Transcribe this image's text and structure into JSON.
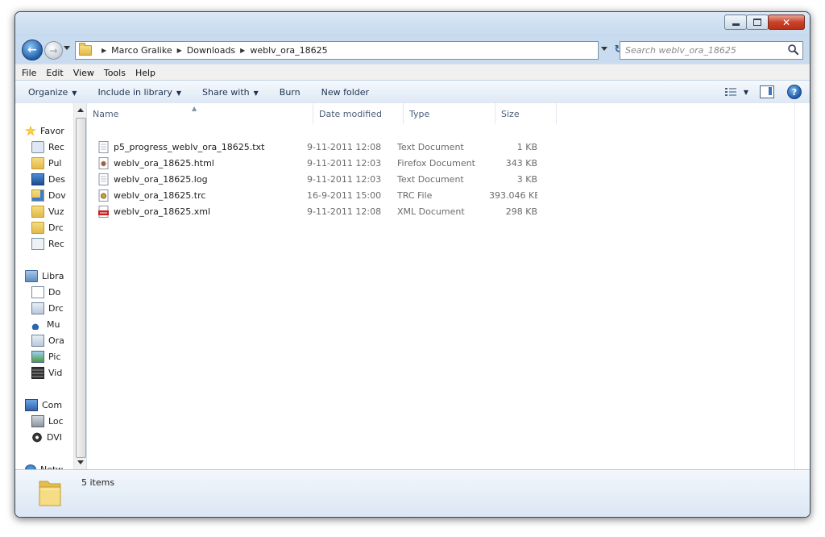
{
  "address": {
    "crumbs": [
      "Marco Gralike",
      "Downloads",
      "weblv_ora_18625"
    ],
    "search_placeholder": "Search weblv_ora_18625"
  },
  "menu": [
    "File",
    "Edit",
    "View",
    "Tools",
    "Help"
  ],
  "toolbar": {
    "organize": "Organize",
    "include": "Include in library",
    "share": "Share with",
    "burn": "Burn",
    "new_folder": "New folder"
  },
  "nav": [
    {
      "label": "Favor",
      "icon": "star-icon"
    },
    {
      "label": "Rec",
      "icon": "recent-places-icon"
    },
    {
      "label": "Pul",
      "icon": "folder-icon"
    },
    {
      "label": "Des",
      "icon": "desktop-icon"
    },
    {
      "label": "Dov",
      "icon": "downloads-folder-icon"
    },
    {
      "label": "Vuz",
      "icon": "folder-icon"
    },
    {
      "label": "Drc",
      "icon": "folder-icon"
    },
    {
      "label": "Rec",
      "icon": "recent-items-icon"
    },
    {
      "label": "Libra",
      "icon": "libraries-icon"
    },
    {
      "label": "Do",
      "icon": "documents-icon"
    },
    {
      "label": "Drc",
      "icon": "library-icon"
    },
    {
      "label": "Mu",
      "icon": "music-icon"
    },
    {
      "label": "Ora",
      "icon": "library-icon"
    },
    {
      "label": "Pic",
      "icon": "pictures-icon"
    },
    {
      "label": "Vid",
      "icon": "videos-icon"
    },
    {
      "label": "Com",
      "icon": "computer-icon"
    },
    {
      "label": "Loc",
      "icon": "local-disk-icon"
    },
    {
      "label": "DVI",
      "icon": "dvd-drive-icon"
    },
    {
      "label": "Netw",
      "icon": "network-icon"
    }
  ],
  "columns": [
    "Name",
    "Date modified",
    "Type",
    "Size"
  ],
  "files": [
    {
      "name": "p5_progress_weblv_ora_18625.txt",
      "date": "9-11-2011 12:08",
      "type": "Text Document",
      "size": "1 KB",
      "icon": "text-file-icon"
    },
    {
      "name": "weblv_ora_18625.html",
      "date": "9-11-2011 12:03",
      "type": "Firefox Document",
      "size": "343 KB",
      "icon": "html-file-icon"
    },
    {
      "name": "weblv_ora_18625.log",
      "date": "9-11-2011 12:03",
      "type": "Text Document",
      "size": "3 KB",
      "icon": "text-file-icon"
    },
    {
      "name": "weblv_ora_18625.trc",
      "date": "16-9-2011 15:00",
      "type": "TRC File",
      "size": "393.046 KB",
      "icon": "trc-file-icon"
    },
    {
      "name": "weblv_ora_18625.xml",
      "date": "9-11-2011 12:08",
      "type": "XML Document",
      "size": "298 KB",
      "icon": "xml-file-icon"
    }
  ],
  "status": {
    "items": "5 items"
  }
}
